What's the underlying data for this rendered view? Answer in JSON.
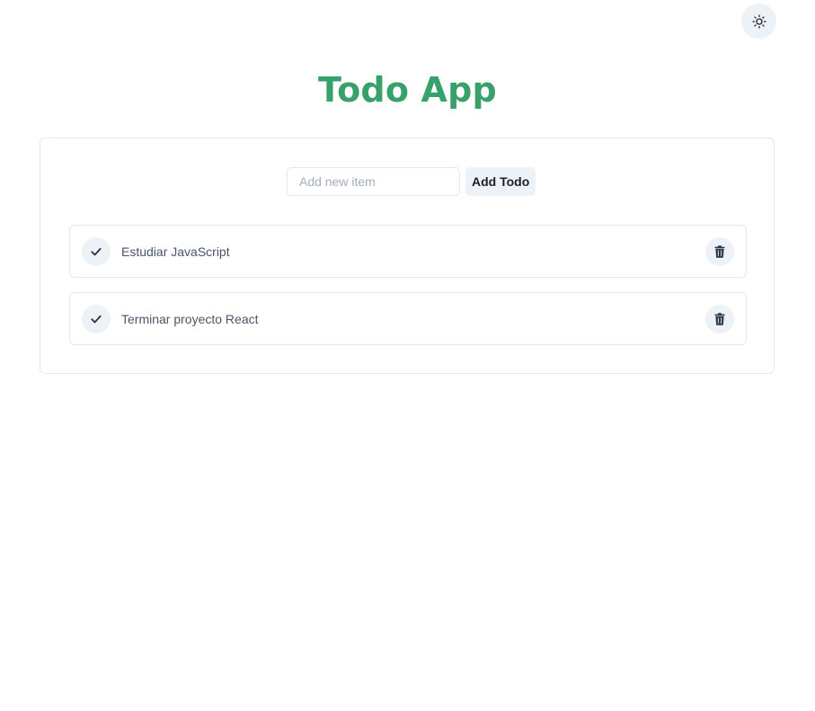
{
  "app": {
    "title": "Todo App",
    "accent_color": "#38a169"
  },
  "theme_toggle": {
    "icon": "sun-icon"
  },
  "form": {
    "input_placeholder": "Add new item",
    "input_value": "",
    "add_label": "Add Todo"
  },
  "todos": [
    {
      "text": "Estudiar JavaScript",
      "check_icon": "check-icon",
      "delete_icon": "trash-icon"
    },
    {
      "text": "Terminar proyecto React",
      "check_icon": "check-icon",
      "delete_icon": "trash-icon"
    }
  ]
}
